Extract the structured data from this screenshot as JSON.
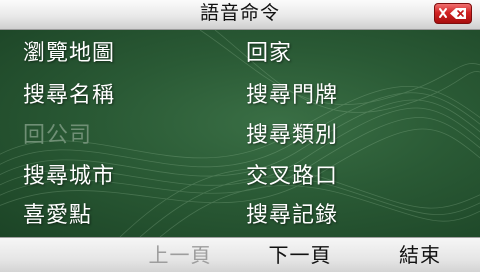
{
  "header": {
    "title": "語音命令",
    "close_icon": "close-icon",
    "close_color": "#d22424"
  },
  "menu": {
    "left": [
      {
        "label": "瀏覽地圖",
        "enabled": true
      },
      {
        "label": "搜尋名稱",
        "enabled": true
      },
      {
        "label": "回公司",
        "enabled": false
      },
      {
        "label": "搜尋城市",
        "enabled": true
      },
      {
        "label": "喜愛點",
        "enabled": true
      }
    ],
    "right": [
      {
        "label": "回家",
        "enabled": true
      },
      {
        "label": "搜尋門牌",
        "enabled": true
      },
      {
        "label": "搜尋類別",
        "enabled": true
      },
      {
        "label": "交叉路口",
        "enabled": true
      },
      {
        "label": "搜尋記錄",
        "enabled": true
      }
    ]
  },
  "footer": {
    "prev_label": "上一頁",
    "prev_enabled": false,
    "next_label": "下一頁",
    "end_label": "結束"
  },
  "colors": {
    "panel_green": "#2a5a35",
    "disabled_text": "#6f8f75"
  }
}
